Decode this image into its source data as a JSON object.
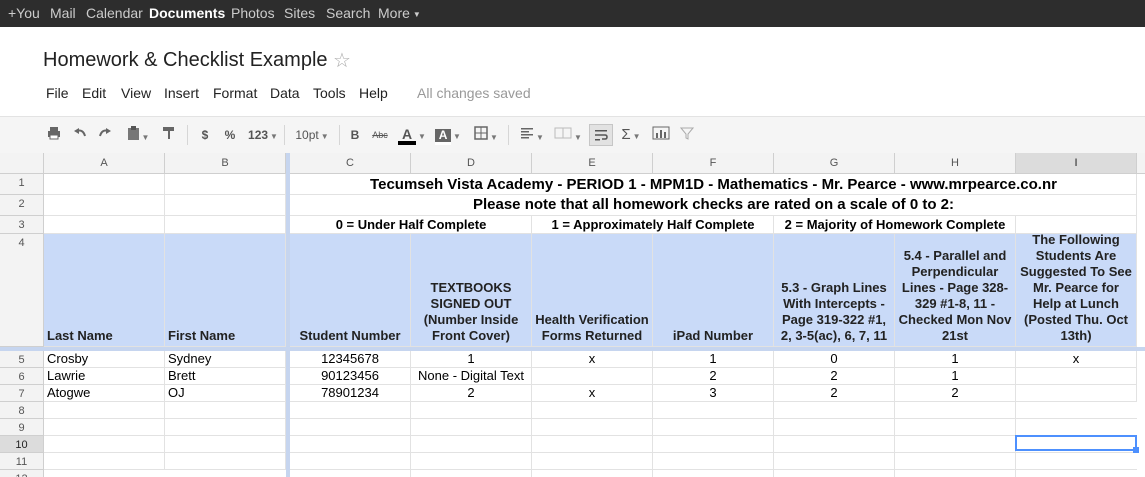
{
  "nav": {
    "items": [
      "+You",
      "Mail",
      "Calendar",
      "Documents",
      "Photos",
      "Sites",
      "Search",
      "More"
    ],
    "active": "Documents"
  },
  "document": {
    "title": "Homework & Checklist Example",
    "save_status": "All changes saved"
  },
  "menu": [
    "File",
    "Edit",
    "View",
    "Insert",
    "Format",
    "Data",
    "Tools",
    "Help"
  ],
  "toolbar": {
    "currency": "$",
    "percent": "%",
    "number_format": "123",
    "font_size": "10pt",
    "bold": "B",
    "strikethrough": "Abc",
    "text_color_glyph": "A",
    "fill_color_glyph": "A",
    "sum": "Σ"
  },
  "columns": [
    "A",
    "B",
    "C",
    "D",
    "E",
    "F",
    "G",
    "H",
    "I"
  ],
  "rows": [
    "1",
    "2",
    "3",
    "4",
    "5",
    "6",
    "7",
    "8",
    "9",
    "10",
    "11",
    "12"
  ],
  "sheet": {
    "row1": "Tecumseh Vista Academy - PERIOD 1 - MPM1D - Mathematics - Mr. Pearce - www.mrpearce.co.nr",
    "row2": "Please note that all homework checks are rated on a scale of 0 to 2:",
    "row3": {
      "scale0": "0 = Under Half Complete",
      "scale1": "1 = Approximately Half Complete",
      "scale2": "2 = Majority of Homework Complete"
    },
    "headers": {
      "A": "Last Name",
      "B": "First Name",
      "C": "Student Number",
      "D": "TEXTBOOKS SIGNED OUT (Number Inside Front Cover)",
      "E": "Health Verification Forms Returned",
      "F": "iPad Number",
      "G": "5.3 - Graph Lines With Intercepts - Page 319-322 #1, 2, 3-5(ac), 6, 7, 11",
      "H": "5.4 - Parallel and Perpendicular Lines - Page 328-329 #1-8, 11 - Checked Mon Nov 21st",
      "I": "The Following Students Are Suggested To See Mr. Pearce for Help at Lunch (Posted Thu. Oct 13th)"
    },
    "students": [
      {
        "last": "Crosby",
        "first": "Sydney",
        "number": "12345678",
        "textbooks": "1",
        "health": "x",
        "ipad": "1",
        "s53": "0",
        "s54": "1",
        "help": "x"
      },
      {
        "last": "Lawrie",
        "first": "Brett",
        "number": "90123456",
        "textbooks": "None - Digital Text",
        "health": "",
        "ipad": "2",
        "s53": "2",
        "s54": "1",
        "help": ""
      },
      {
        "last": "Atogwe",
        "first": "OJ",
        "number": "78901234",
        "textbooks": "2",
        "health": "x",
        "ipad": "3",
        "s53": "2",
        "s54": "2",
        "help": ""
      }
    ]
  },
  "selection": {
    "column": "I",
    "row": "10"
  }
}
